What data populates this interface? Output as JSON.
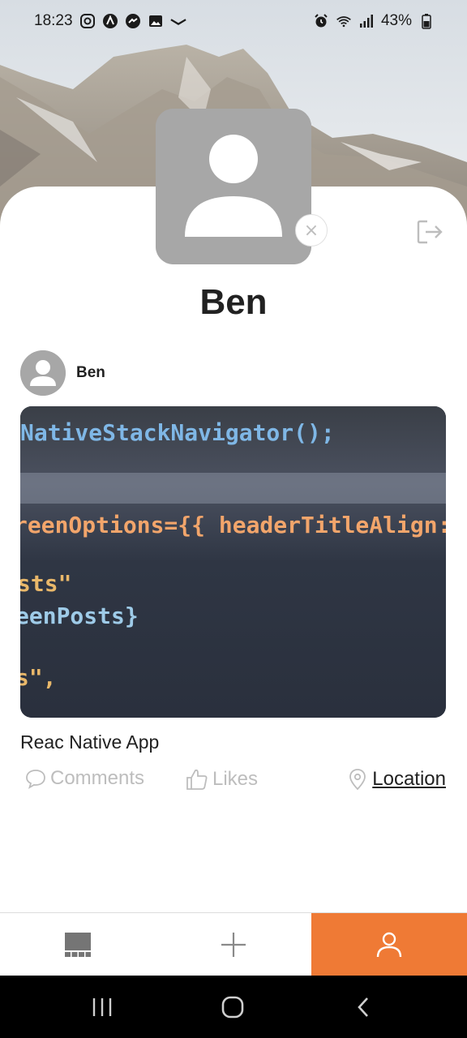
{
  "status_bar": {
    "time": "18:23",
    "battery": "43%",
    "left_icons": [
      "instagram-icon",
      "app-icon",
      "messenger-icon",
      "gallery-icon",
      "notification-icon"
    ],
    "right_icons": [
      "alarm-icon",
      "wifi-icon",
      "signal-icon",
      "battery-icon"
    ]
  },
  "profile": {
    "name": "Ben",
    "avatar_icon": "user-silhouette-icon",
    "remove_icon": "close-icon",
    "logout_icon": "logout-icon"
  },
  "post": {
    "author": "Ben",
    "title": "Reac Native App",
    "image": {
      "description_icon": "code-photo",
      "code_lines": [
        "NativeStackNavigator();",
        "reenOptions={{ headerTitleAlign:",
        "sts\"",
        "eenPosts}",
        "s\","
      ]
    },
    "comments_label": "Comments",
    "likes_label": "Likes",
    "location_label": "Location"
  },
  "tab_bar": {
    "tabs": [
      {
        "name": "posts",
        "icon": "grid-icon",
        "active": false
      },
      {
        "name": "create",
        "icon": "plus-icon",
        "active": false
      },
      {
        "name": "profile",
        "icon": "user-icon",
        "active": true
      }
    ],
    "accent_color": "#ef7a35"
  },
  "nav_bar": {
    "buttons": [
      "recents-icon",
      "home-icon",
      "back-icon"
    ]
  }
}
